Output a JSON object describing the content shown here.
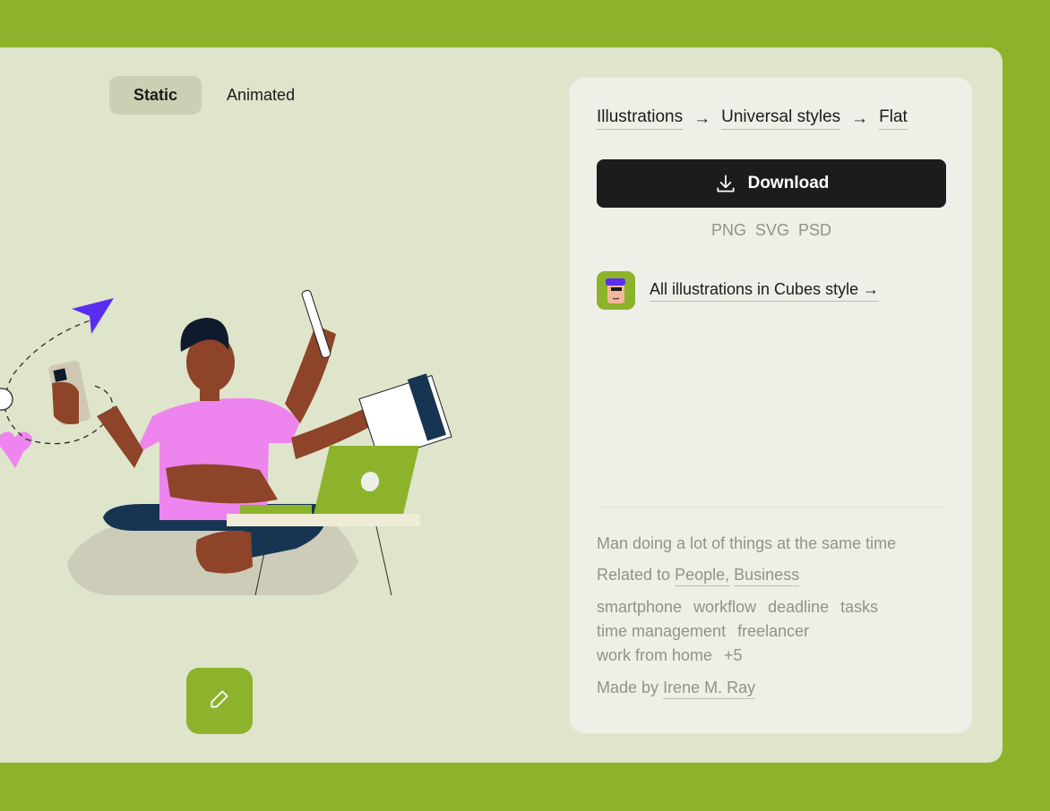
{
  "tabs": {
    "static_label": "Static",
    "animated_label": "Animated"
  },
  "breadcrumb": {
    "items": [
      "Illustrations",
      "Universal styles",
      "Flat"
    ],
    "separator": "→"
  },
  "download": {
    "label": "Download",
    "icon": "download-icon",
    "formats": [
      "PNG",
      "SVG",
      "PSD"
    ]
  },
  "style_link": {
    "label": "All illustrations in Cubes style →",
    "avatar_icon": "cubes-style-avatar"
  },
  "meta": {
    "description": "Man doing a lot of things at the same time",
    "related_prefix": "Related to",
    "related": [
      "People,",
      "Business"
    ],
    "tags_line1": [
      "smartphone",
      "workflow",
      "deadline",
      "tasks"
    ],
    "tags_line2": [
      "time management",
      "freelancer"
    ],
    "tags_line3": [
      "work from home",
      "+5"
    ],
    "made_by_prefix": "Made by",
    "author": "Irene M. Ray"
  },
  "edit": {
    "icon": "pencil-icon"
  },
  "colors": {
    "brand_green": "#8db32c",
    "card_bg": "#dfe5cb",
    "panel_bg": "#eef0e8",
    "download_bg": "#1c1c1c"
  }
}
